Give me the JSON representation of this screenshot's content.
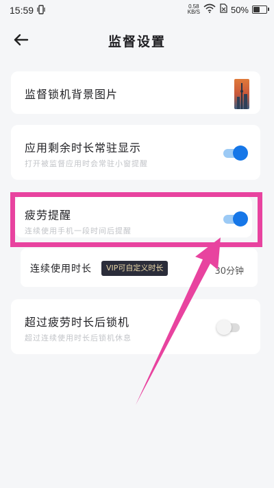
{
  "status_bar": {
    "time": "15:59",
    "net_speed_value": "0.58",
    "net_speed_unit": "KB/S",
    "battery": "50%",
    "battery_level": 0.5
  },
  "header": {
    "title": "监督设置"
  },
  "settings": {
    "lock_background": {
      "title": "监督锁机背景图片"
    },
    "app_time_display": {
      "title": "应用剩余时长常驻显示",
      "subtitle": "打开被监督应用时会常驻小窗提醒",
      "enabled": true
    },
    "fatigue_reminder": {
      "title": "疲劳提醒",
      "subtitle": "连续使用手机一段时间后提醒",
      "enabled": true
    },
    "continuous_duration": {
      "label": "连续使用时长",
      "vip_badge": "VIP可自定义时长",
      "value": "30分钟"
    },
    "lock_after_fatigue": {
      "title": "超过疲劳时长后锁机",
      "subtitle": "超过连续使用时长后锁机休息",
      "enabled": false
    }
  },
  "annotation": {
    "color": "#e8439f"
  }
}
